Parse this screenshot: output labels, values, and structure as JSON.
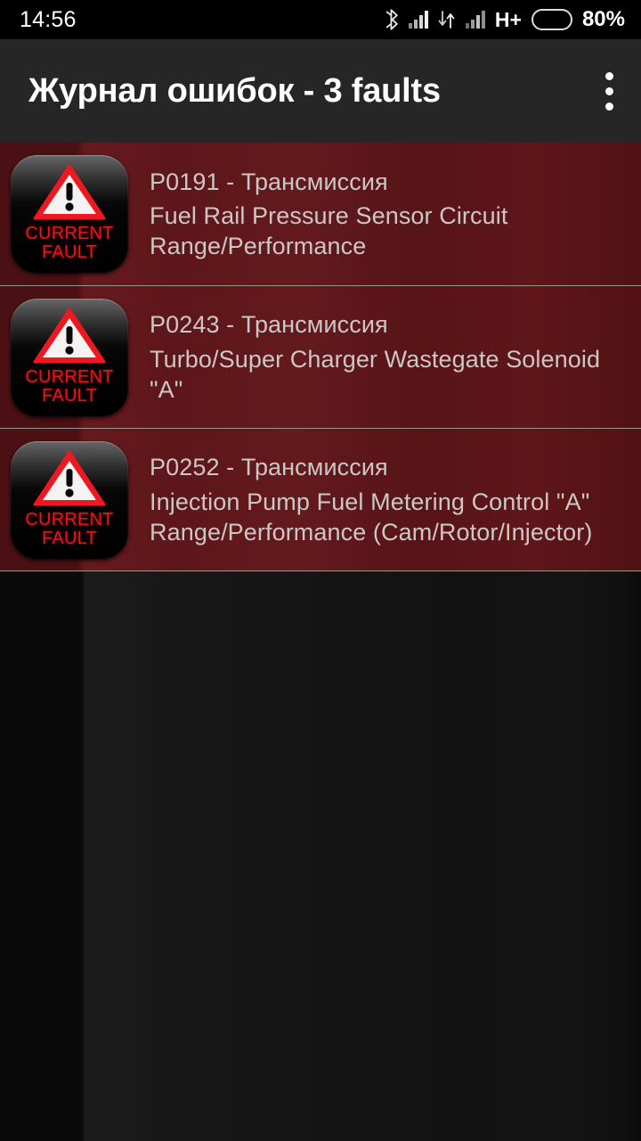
{
  "status_bar": {
    "clock": "14:56",
    "bluetooth_icon": "bluetooth-icon",
    "signal_icon_1": "signal-bars-icon",
    "data_transfer_icon": "data-transfer-arrows-icon",
    "signal_icon_2": "signal-bars-icon",
    "network_type": "H+",
    "battery_icon": "battery-icon",
    "battery_level_pct": 80,
    "battery_label": "80%",
    "background_color": "#000000"
  },
  "title_bar": {
    "title": "Журнал ошибок - 3 faults",
    "overflow_menu_icon": "overflow-menu-icon",
    "background_color": "#262626",
    "text_color": "#ffffff"
  },
  "fault_list": {
    "row_background_color": "#5c1619",
    "divider_color": "#9e9490",
    "text_color": "#ccc7c5",
    "badge": {
      "warning_icon": "warning-triangle-icon",
      "line1": "CURRENT",
      "line2": "FAULT",
      "text_color": "#e8131b",
      "background_color": "#000000"
    },
    "rows": [
      {
        "code_line": "P0191 - Трансмиссия",
        "description": "Fuel Rail Pressure Sensor Circuit Range/Performance"
      },
      {
        "code_line": "P0243 - Трансмиссия",
        "description": "Turbo/Super Charger Wastegate Solenoid \"A\""
      },
      {
        "code_line": "P0252 - Трансмиссия",
        "description": "Injection Pump Fuel Metering Control \"A\" Range/Performance (Cam/Rotor/Injector)"
      }
    ]
  },
  "background": {
    "color": "#0e0e0e",
    "texture": "dark-concrete-texture"
  }
}
